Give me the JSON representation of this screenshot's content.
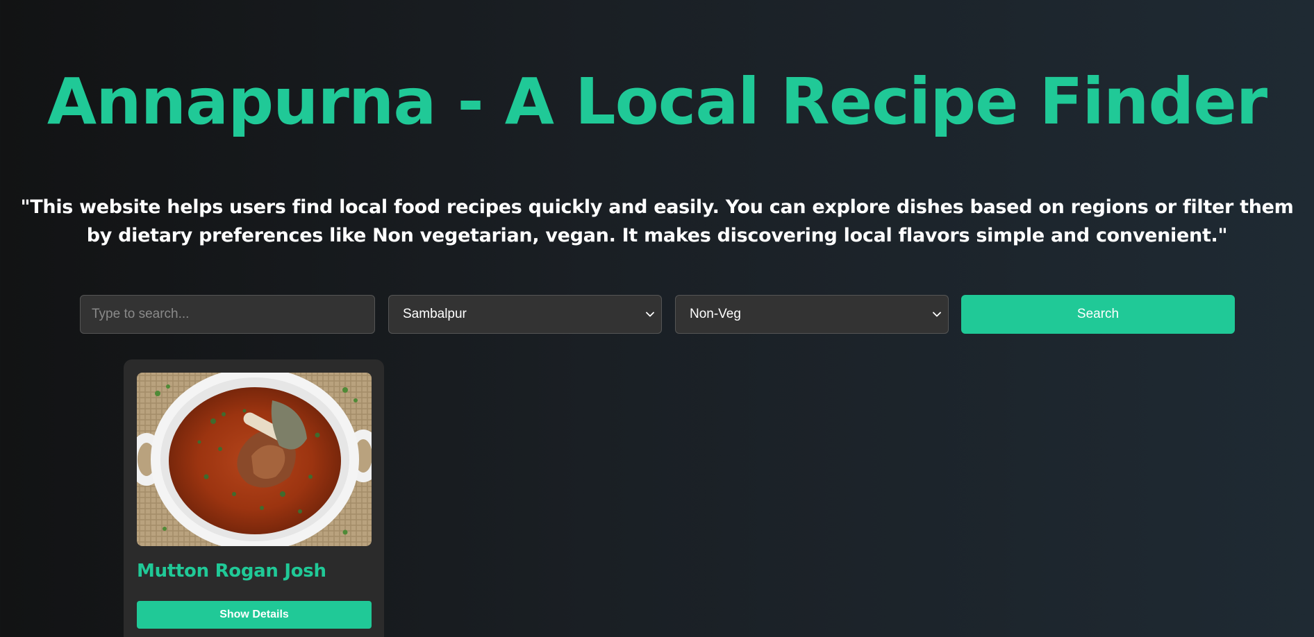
{
  "header": {
    "title": "Annapurna - A Local Recipe Finder",
    "tagline": "\"This website helps users find local food recipes quickly and easily. You can explore dishes based on regions or filter them by dietary preferences like Non vegetarian, vegan. It makes discovering local flavors simple and convenient.\""
  },
  "search": {
    "placeholder": "Type to search...",
    "value": "",
    "region_selected": "Sambalpur",
    "diet_selected": "Non-Veg",
    "button_label": "Search"
  },
  "results": [
    {
      "title": "Mutton Rogan Josh",
      "button_label": "Show Details",
      "image": "mutton-curry-bowl-photo"
    }
  ],
  "colors": {
    "accent": "#20c997",
    "background_dark": "#121314",
    "background_light": "#1f2a33",
    "card": "#2b2b2b",
    "input": "#333333"
  },
  "icons": {
    "select_chevron": "chevron-down-icon"
  }
}
